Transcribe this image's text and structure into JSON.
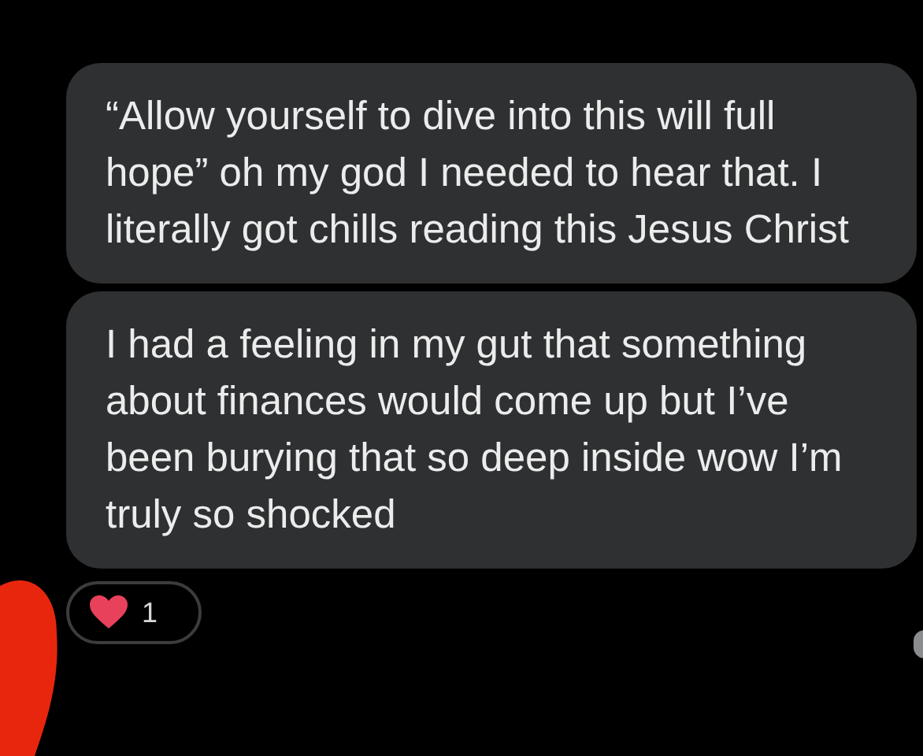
{
  "messages": [
    {
      "text": "“Allow yourself to dive into this will full hope” oh my god I needed to hear that. I literally got chills reading this Jesus Christ"
    },
    {
      "text": "I had a feeling in my gut that something about finances would come up but I’ve been burying that so deep inside wow I’m truly so shocked"
    }
  ],
  "reaction": {
    "count": "1"
  }
}
